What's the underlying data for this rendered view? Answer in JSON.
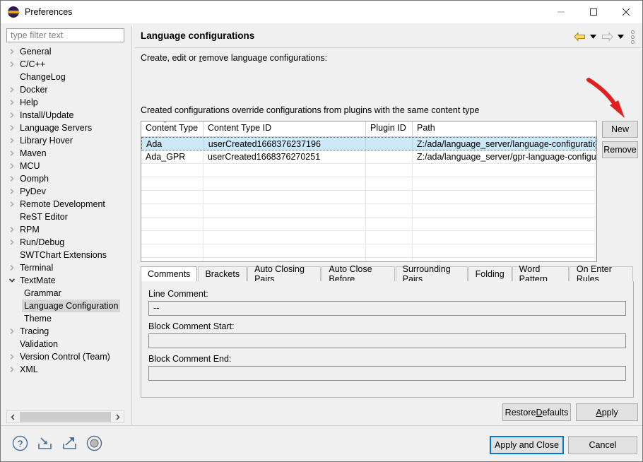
{
  "window": {
    "title": "Preferences",
    "icon": "eclipse-icon",
    "controls": {
      "minimize": "minimize-icon",
      "maximize": "maximize-icon",
      "close": "close-icon"
    }
  },
  "sidebar": {
    "filter": {
      "placeholder": "type filter text",
      "value": ""
    },
    "items": [
      {
        "label": "General",
        "expandable": true,
        "expanded": false,
        "level": 1
      },
      {
        "label": "C/C++",
        "expandable": true,
        "expanded": false,
        "level": 1
      },
      {
        "label": "ChangeLog",
        "expandable": false,
        "expanded": false,
        "level": 1
      },
      {
        "label": "Docker",
        "expandable": true,
        "expanded": false,
        "level": 1
      },
      {
        "label": "Help",
        "expandable": true,
        "expanded": false,
        "level": 1
      },
      {
        "label": "Install/Update",
        "expandable": true,
        "expanded": false,
        "level": 1
      },
      {
        "label": "Language Servers",
        "expandable": true,
        "expanded": false,
        "level": 1
      },
      {
        "label": "Library Hover",
        "expandable": true,
        "expanded": false,
        "level": 1
      },
      {
        "label": "Maven",
        "expandable": true,
        "expanded": false,
        "level": 1
      },
      {
        "label": "MCU",
        "expandable": true,
        "expanded": false,
        "level": 1
      },
      {
        "label": "Oomph",
        "expandable": true,
        "expanded": false,
        "level": 1
      },
      {
        "label": "PyDev",
        "expandable": true,
        "expanded": false,
        "level": 1
      },
      {
        "label": "Remote Development",
        "expandable": true,
        "expanded": false,
        "level": 1
      },
      {
        "label": "ReST Editor",
        "expandable": false,
        "expanded": false,
        "level": 1
      },
      {
        "label": "RPM",
        "expandable": true,
        "expanded": false,
        "level": 1
      },
      {
        "label": "Run/Debug",
        "expandable": true,
        "expanded": false,
        "level": 1
      },
      {
        "label": "SWTChart Extensions",
        "expandable": false,
        "expanded": false,
        "level": 1
      },
      {
        "label": "Terminal",
        "expandable": true,
        "expanded": false,
        "level": 1
      },
      {
        "label": "TextMate",
        "expandable": true,
        "expanded": true,
        "level": 1
      },
      {
        "label": "Grammar",
        "expandable": false,
        "expanded": false,
        "level": 2
      },
      {
        "label": "Language Configuration",
        "expandable": false,
        "expanded": false,
        "level": 2,
        "selected": true
      },
      {
        "label": "Theme",
        "expandable": false,
        "expanded": false,
        "level": 2
      },
      {
        "label": "Tracing",
        "expandable": true,
        "expanded": false,
        "level": 1
      },
      {
        "label": "Validation",
        "expandable": false,
        "expanded": false,
        "level": 1
      },
      {
        "label": "Version Control (Team)",
        "expandable": true,
        "expanded": false,
        "level": 1
      },
      {
        "label": "XML",
        "expandable": true,
        "expanded": false,
        "level": 1
      }
    ],
    "scrollbar": {
      "left_arrow": "chevron-left-icon",
      "right_arrow": "chevron-right-icon"
    }
  },
  "page": {
    "title": "Language configurations",
    "description": "Create, edit or remove language configurations:",
    "subdescription": "Created configurations override configurations from plugins with the same content type",
    "nav": {
      "back": "back-arrow-icon",
      "back_menu": "chevron-down-icon",
      "forward": "forward-arrow-icon",
      "forward_menu": "chevron-down-icon",
      "overflow": "kebab-menu-icon"
    }
  },
  "table": {
    "columns": [
      "Content Type",
      "Content Type ID",
      "Plugin ID",
      "Path"
    ],
    "sort_column": 0,
    "sort_indicator": "chevron-up-icon",
    "rows": [
      {
        "selected": true,
        "cells": [
          "Ada",
          "userCreated1668376237196",
          "",
          "Z:/ada/language_server/language-configuration.json"
        ]
      },
      {
        "selected": false,
        "cells": [
          "Ada_GPR",
          "userCreated1668376270251",
          "",
          "Z:/ada/language_server/gpr-language-configuration.json"
        ]
      }
    ],
    "empty_row_count": 8
  },
  "side_buttons": {
    "new": "New",
    "remove": "Remove"
  },
  "annotation": {
    "arrow_color": "#e02020",
    "points_to": "new-button"
  },
  "tabs": [
    {
      "label": "Comments",
      "active": true
    },
    {
      "label": "Brackets",
      "active": false
    },
    {
      "label": "Auto Closing Pairs",
      "active": false
    },
    {
      "label": "Auto Close Before",
      "active": false
    },
    {
      "label": "Surrounding Pairs",
      "active": false
    },
    {
      "label": "Folding",
      "active": false
    },
    {
      "label": "Word Pattern",
      "active": false
    },
    {
      "label": "On Enter Rules",
      "active": false
    }
  ],
  "comments_tab": {
    "line_comment_label": "Line Comment:",
    "line_comment_value": "--",
    "block_comment_start_label": "Block Comment Start:",
    "block_comment_start_value": "",
    "block_comment_end_label": "Block Comment End:",
    "block_comment_end_value": ""
  },
  "footer": {
    "restore_defaults": "Restore Defaults",
    "restore_defaults_mnemonic": "D",
    "apply": "Apply",
    "apply_mnemonic": "A",
    "apply_and_close": "Apply and Close",
    "cancel": "Cancel",
    "tools": [
      {
        "name": "help-icon"
      },
      {
        "name": "import-icon"
      },
      {
        "name": "export-icon"
      },
      {
        "name": "oomph-recorder-icon"
      }
    ]
  },
  "colors": {
    "selection": "#cde8f7",
    "focus_border": "#0078d7",
    "accent_arrow": "#e8a317",
    "annotation_red": "#e02020",
    "dialog_bg": "#f0f0f0"
  }
}
